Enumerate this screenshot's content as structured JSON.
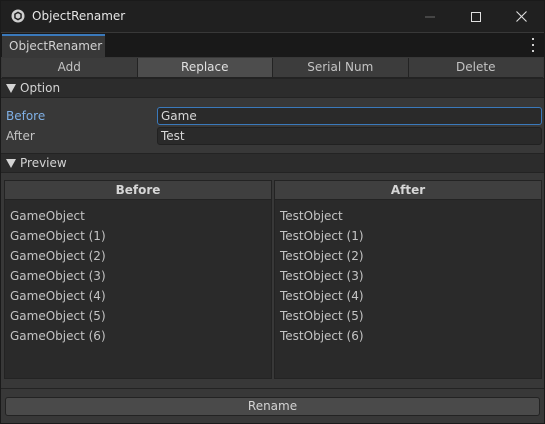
{
  "window": {
    "title": "ObjectRenamer"
  },
  "tab": {
    "label": "ObjectRenamer"
  },
  "toolbar": {
    "buttons": [
      "Add",
      "Replace",
      "Serial Num",
      "Delete"
    ],
    "active": "Replace"
  },
  "option": {
    "header": "Option",
    "before_label": "Before",
    "before_value": "Game",
    "after_label": "After",
    "after_value": "Test"
  },
  "preview": {
    "header": "Preview",
    "before_header": "Before",
    "after_header": "After",
    "before_items": [
      "GameObject",
      "GameObject (1)",
      "GameObject (2)",
      "GameObject (3)",
      "GameObject (4)",
      "GameObject (5)",
      "GameObject (6)"
    ],
    "after_items": [
      "TestObject",
      "TestObject (1)",
      "TestObject (2)",
      "TestObject (3)",
      "TestObject (4)",
      "TestObject (5)",
      "TestObject (6)"
    ]
  },
  "rename_button": "Rename",
  "colors": {
    "accent": "#3a79bb",
    "focused_label": "#7fb0e6",
    "background": "#383838"
  },
  "icons": {
    "app": "unity-logo-icon",
    "minimize": "minimize-icon",
    "maximize": "maximize-icon",
    "close": "close-icon",
    "tab_menu": "kebab-menu-icon",
    "foldout": "triangle-down-icon"
  }
}
